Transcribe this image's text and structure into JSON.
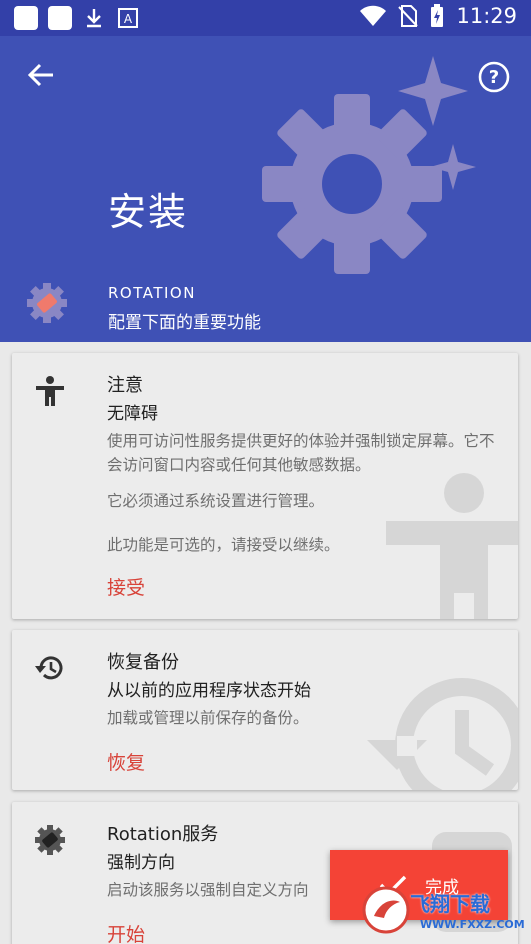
{
  "status_bar": {
    "time": "11:29"
  },
  "header": {
    "title": "安装",
    "app_name": "ROTATION",
    "app_description": "配置下面的重要功能",
    "icons": [
      "back-arrow-icon",
      "help-icon",
      "gear-icon",
      "sparkle-icon"
    ]
  },
  "cards": [
    {
      "title": "注意",
      "subtitle": "无障碍",
      "body": [
        "使用可访问性服务提供更好的体验并强制锁定屏幕。它不会访问窗口内容或任何其他敏感数据。",
        "它必须通过系统设置进行管理。",
        "此功能是可选的，请接受以继续。"
      ],
      "action": "接受",
      "icon": "accessibility-icon"
    },
    {
      "title": "恢复备份",
      "subtitle": "从以前的应用程序状态开始",
      "body": [
        "加载或管理以前保存的备份。"
      ],
      "action": "恢复",
      "icon": "history-icon"
    },
    {
      "title": "Rotation服务",
      "subtitle": "强制方向",
      "body": [
        "启动该服务以强制自定义方向"
      ],
      "action": "开始",
      "icon": "rotation-service-icon"
    }
  ],
  "done_button": {
    "label": "完成",
    "icon": "check-icon"
  },
  "watermark": {
    "text": "飞翔下载",
    "url": "WWW.FXXZ.COM"
  },
  "colors": {
    "header": "#3f51b5",
    "status_bar": "#3340a8",
    "accent": "#d84339",
    "fab": "#f44336",
    "decor": "#8a87c4"
  }
}
